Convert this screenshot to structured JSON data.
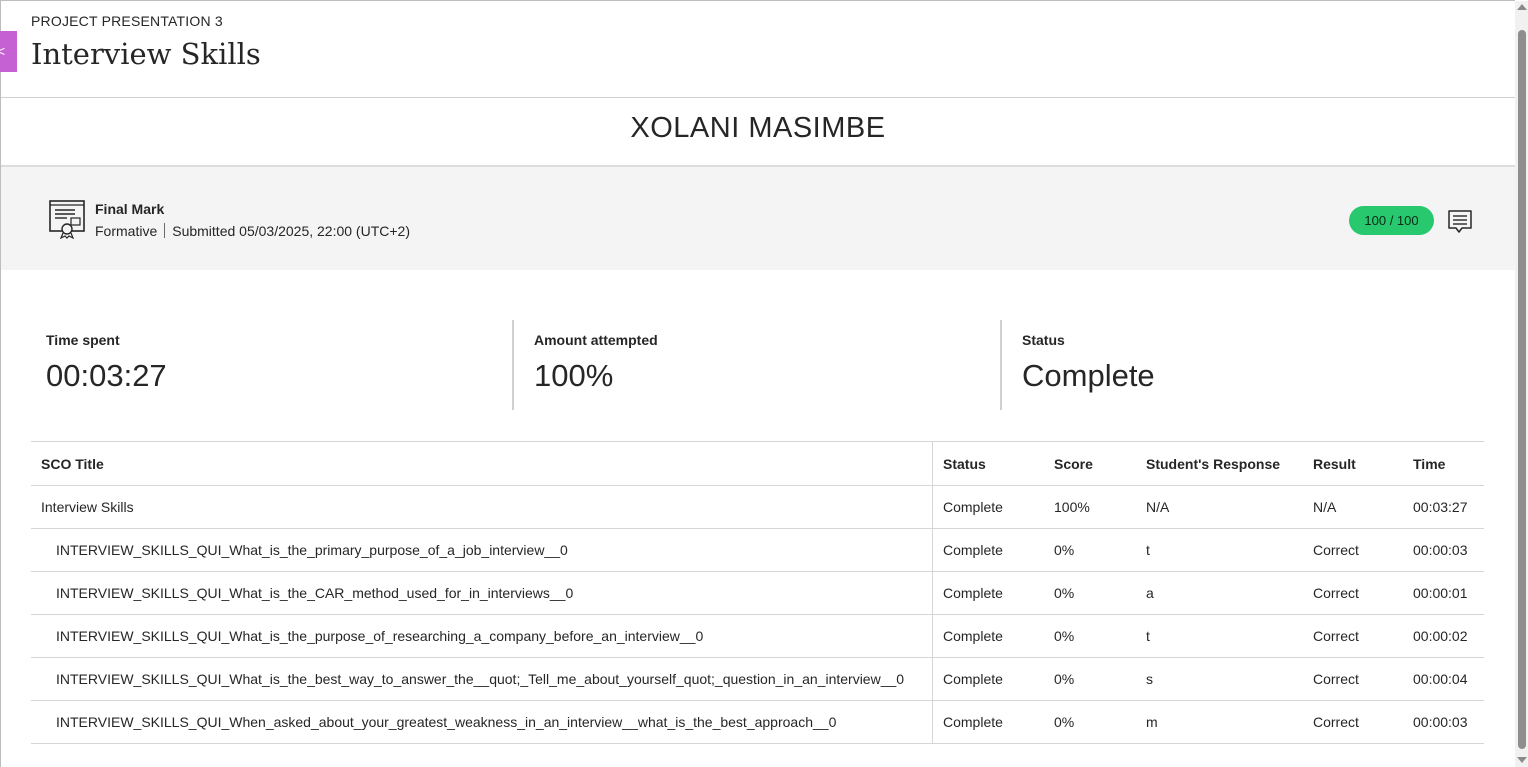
{
  "header": {
    "eyebrow": "PROJECT PRESENTATION 3",
    "title": "Interview Skills",
    "close_glyph": "<"
  },
  "student": {
    "name": "XOLANI MASIMBE"
  },
  "final_mark": {
    "title": "Final Mark",
    "type": "Formative",
    "submitted": "Submitted 05/03/2025, 22:00 (UTC+2)",
    "grade": "100 / 100",
    "icon": "certificate-icon",
    "feedback_icon": "feedback-comment-icon"
  },
  "stats": [
    {
      "label": "Time spent",
      "value": "00:03:27"
    },
    {
      "label": "Amount attempted",
      "value": "100%"
    },
    {
      "label": "Status",
      "value": "Complete"
    }
  ],
  "table": {
    "headers": [
      "SCO Title",
      "Status",
      "Score",
      "Student's Response",
      "Result",
      "Time"
    ],
    "rows": [
      [
        "Interview Skills",
        "Complete",
        "100%",
        "N/A",
        "N/A",
        "00:03:27"
      ],
      [
        "INTERVIEW_SKILLS_QUI_What_is_the_primary_purpose_of_a_job_interview__0",
        "Complete",
        "0%",
        "t",
        "Correct",
        "00:00:03"
      ],
      [
        "INTERVIEW_SKILLS_QUI_What_is_the_CAR_method_used_for_in_interviews__0",
        "Complete",
        "0%",
        "a",
        "Correct",
        "00:00:01"
      ],
      [
        "INTERVIEW_SKILLS_QUI_What_is_the_purpose_of_researching_a_company_before_an_interview__0",
        "Complete",
        "0%",
        "t",
        "Correct",
        "00:00:02"
      ],
      [
        "INTERVIEW_SKILLS_QUI_What_is_the_best_way_to_answer_the__quot;_Tell_me_about_yourself_quot;_question_in_an_interview__0",
        "Complete",
        "0%",
        "s",
        "Correct",
        "00:00:04"
      ],
      [
        "INTERVIEW_SKILLS_QUI_When_asked_about_your_greatest_weakness_in_an_interview__what_is_the_best_approach__0",
        "Complete",
        "0%",
        "m",
        "Correct",
        "00:00:03"
      ]
    ]
  },
  "colors": {
    "accent_tab": "#c561d3",
    "grade_pill": "#27c86e",
    "band_bg": "#f4f4f4"
  }
}
